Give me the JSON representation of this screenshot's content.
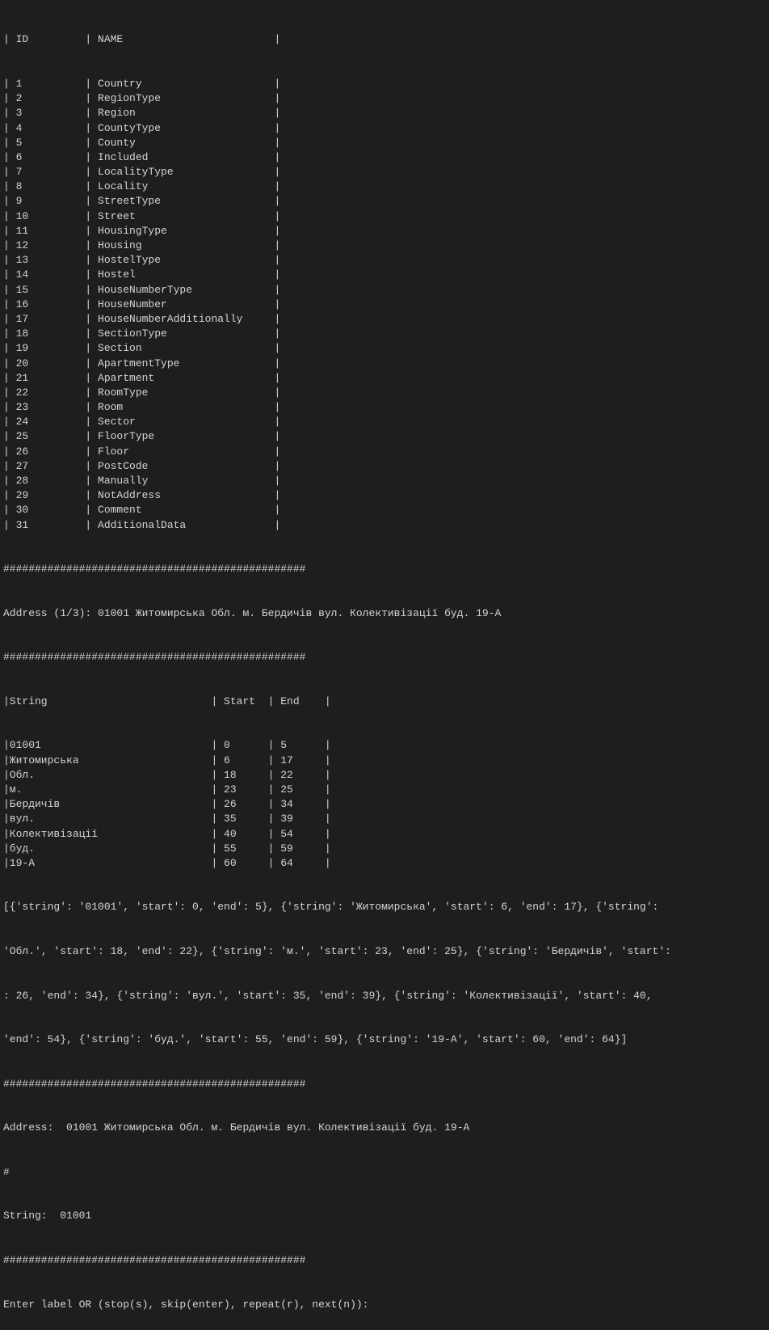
{
  "table": {
    "header": "| ID         | NAME                        |",
    "rows": [
      "| 1          | Country                     |",
      "| 2          | RegionType                  |",
      "| 3          | Region                      |",
      "| 4          | CountyType                  |",
      "| 5          | County                      |",
      "| 6          | Included                    |",
      "| 7          | LocalityType                |",
      "| 8          | Locality                    |",
      "| 9          | StreetType                  |",
      "| 10         | Street                      |",
      "| 11         | HousingType                 |",
      "| 12         | Housing                     |",
      "| 13         | HostelType                  |",
      "| 14         | Hostel                      |",
      "| 15         | HouseNumberType             |",
      "| 16         | HouseNumber                 |",
      "| 17         | HouseNumberAdditionally     |",
      "| 18         | SectionType                 |",
      "| 19         | Section                     |",
      "| 20         | ApartmentType               |",
      "| 21         | Apartment                   |",
      "| 22         | RoomType                    |",
      "| 23         | Room                        |",
      "| 24         | Sector                      |",
      "| 25         | FloorType                   |",
      "| 26         | Floor                       |",
      "| 27         | PostCode                    |",
      "| 28         | Manually                    |",
      "| 29         | NotAddress                  |",
      "| 30         | Comment                     |",
      "| 31         | AdditionalData              |"
    ]
  },
  "separator1": "################################################",
  "address_line1": "Address (1/3): 01001 Житомирська Обл. м. Бердичів вул. Колективізації буд. 19-А",
  "separator2": "################################################",
  "string_table": {
    "header": "|String                          | Start  | End    |",
    "rows": [
      "|01001                           | 0      | 5      |",
      "|Житомирська                     | 6      | 17     |",
      "|Обл.                            | 18     | 22     |",
      "|м.                              | 23     | 25     |",
      "|Бердичів                        | 26     | 34     |",
      "|вул.                            | 35     | 39     |",
      "|Колективізації                  | 40     | 54     |",
      "|буд.                            | 55     | 59     |",
      "|19-А                            | 60     | 64     |"
    ]
  },
  "json_line1": "[{'string': '01001', 'start': 0, 'end': 5}, {'string': 'Житомирська', 'start': 6, 'end': 17}, {'string':",
  "json_line2": "'Обл.', 'start': 18, 'end': 22}, {'string': 'м.', 'start': 23, 'end': 25}, {'string': 'Бердичів', 'start':",
  "json_line3": ": 26, 'end': 34}, {'string': 'вул.', 'start': 35, 'end': 39}, {'string': 'Колективізації', 'start': 40,",
  "json_line4": "'end': 54}, {'string': 'буд.', 'start': 55, 'end': 59}, {'string': '19-А', 'start': 60, 'end': 64}]",
  "separator3": "################################################",
  "address_result_label": "Address:  01001 Житомирська Обл. м. Бердичів вул. Колективізації буд. 19-А",
  "hash_line": "#",
  "string_result": "String:  01001",
  "separator4": "################################################",
  "prompt": "Enter label OR (stop(s), skip(enter), repeat(r), next(n)):"
}
